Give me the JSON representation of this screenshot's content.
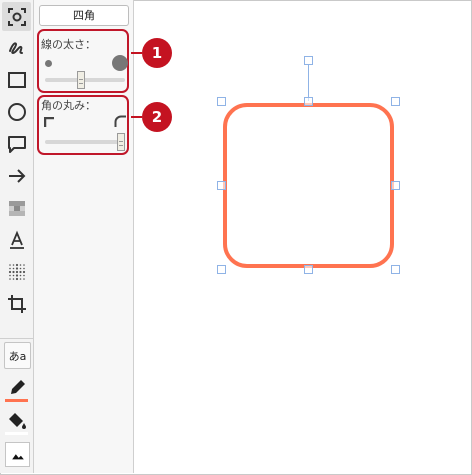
{
  "panel": {
    "shape_button": "四角",
    "line_width_label": "線の太さ：",
    "corner_label": "角の丸み：",
    "line_width_value": 0.45,
    "corner_value": 0.95
  },
  "callouts": [
    "1",
    "2"
  ],
  "colors": {
    "accent": "#c41321",
    "shape_stroke": "#ff7350",
    "pen_indicator": "#ff7350",
    "selection": "#8fb3e6"
  },
  "icons": [
    "screenshot-select-icon",
    "freehand-icon",
    "rectangle-icon",
    "circle-icon",
    "speech-bubble-icon",
    "arrow-icon",
    "mosaic-icon",
    "text-icon",
    "blur-icon",
    "crop-icon",
    "font-icon",
    "pen-color-icon",
    "fill-color-icon",
    "image-icon"
  ],
  "font_button": "あa"
}
